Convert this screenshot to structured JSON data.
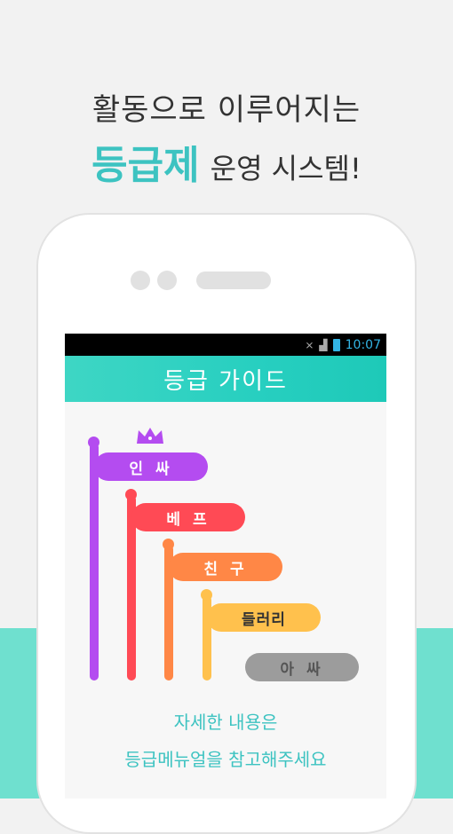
{
  "headline": {
    "line1": "활동으로 이루어지는",
    "highlight": "등급제",
    "line2_rest": "운영 시스템!"
  },
  "status_bar": {
    "time": "10:07",
    "icons": [
      "mute-icon",
      "signal-icon",
      "battery-icon"
    ]
  },
  "app_bar": {
    "title": "등급 가이드"
  },
  "grades": [
    {
      "label": "인 싸",
      "color": "#b44cf0",
      "crown": true
    },
    {
      "label": "베 프",
      "color": "#ff4a55"
    },
    {
      "label": "친 구",
      "color": "#ff8746"
    },
    {
      "label": "들러리",
      "color": "#ffc14d"
    },
    {
      "label": "아 싸",
      "color": "#9c9c9c"
    }
  ],
  "footer": {
    "line1": "자세한 내용은",
    "line2": "등급메뉴얼을 참고해주세요"
  },
  "colors": {
    "accent": "#3dc3c1",
    "band": "#6fe0cf"
  }
}
